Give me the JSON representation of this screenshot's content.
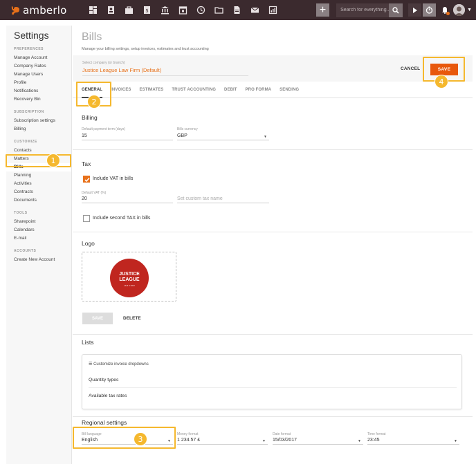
{
  "brand": {
    "name": "amberlo"
  },
  "topbar": {
    "search_placeholder": "Search for everything...",
    "nav_icons": [
      "dashboard-icon",
      "contacts-icon",
      "matters-icon",
      "bills-icon",
      "bank-icon",
      "calendar-icon",
      "history-icon",
      "folder-icon",
      "documents-icon",
      "mail-icon",
      "reports-icon"
    ]
  },
  "sidebar": {
    "title": "Settings",
    "sections": [
      {
        "label": "PREFERENCES",
        "items": [
          "Manage Account",
          "Company Rates",
          "Manage Users",
          "Profile",
          "Notifications",
          "Recovery Bin"
        ]
      },
      {
        "label": "SUBSCRIPTION",
        "items": [
          "Subscription settings",
          "Billing"
        ]
      },
      {
        "label": "CUSTOMIZE",
        "items": [
          "Contacts",
          "Matters",
          "Bills",
          "Planning",
          "Activities",
          "Contracts",
          "Documents"
        ]
      },
      {
        "label": "TOOLS",
        "items": [
          "Sharepoint",
          "Calendars",
          "E-mail"
        ]
      },
      {
        "label": "ACCOUNTS",
        "items": [
          "Create New Account"
        ]
      }
    ],
    "active_item": "Bills"
  },
  "page": {
    "title": "Bills",
    "subtitle": "Manage your billing settings, setup invoices, estimates and trust accounting"
  },
  "company": {
    "label": "Select company (or branch)",
    "value": "Justice League Law Firm (Default)",
    "cancel_label": "CANCEL",
    "save_label": "SAVE"
  },
  "tabs": [
    "GENERAL",
    "INVOICES",
    "ESTIMATES",
    "TRUST ACCOUNTING",
    "DEBIT",
    "PRO FORMA",
    "SENDING"
  ],
  "billing": {
    "title": "Billing",
    "term_label": "Default payment term (days)",
    "term_value": "15",
    "currency_label": "Bills currency",
    "currency_value": "GBP"
  },
  "tax": {
    "title": "Tax",
    "vat_checkbox_label": "Include VAT in bills",
    "vat_checked": true,
    "vat_label": "Default VAT (%)",
    "vat_value": "20",
    "custom_tax_placeholder": "Set custom tax name",
    "second_tax_label": "Include second TAX in bills",
    "second_tax_checked": false
  },
  "logo": {
    "title": "Logo",
    "image_line1": "JUSTICE",
    "image_line2": "LEAGUE",
    "image_line3": "LAW FIRM",
    "save_label": "SAVE",
    "delete_label": "DELETE"
  },
  "lists": {
    "title": "Lists",
    "card_header": "Customize invoice dropdowns",
    "items": [
      "Quantity types",
      "Available tax rates"
    ]
  },
  "regional": {
    "title": "Regional settings",
    "language_label": "Bill language",
    "language_value": "English",
    "money_label": "Money format",
    "money_value": "1 234.57 £",
    "date_label": "Date format",
    "date_value": "15/03/2017",
    "time_label": "Time format",
    "time_value": "23:45"
  },
  "annotations": [
    "1",
    "2",
    "3",
    "4"
  ],
  "colors": {
    "accent": "#e8711a",
    "save": "#e8580c",
    "topbar": "#3b2a2e",
    "highlight": "#f5b82e"
  }
}
